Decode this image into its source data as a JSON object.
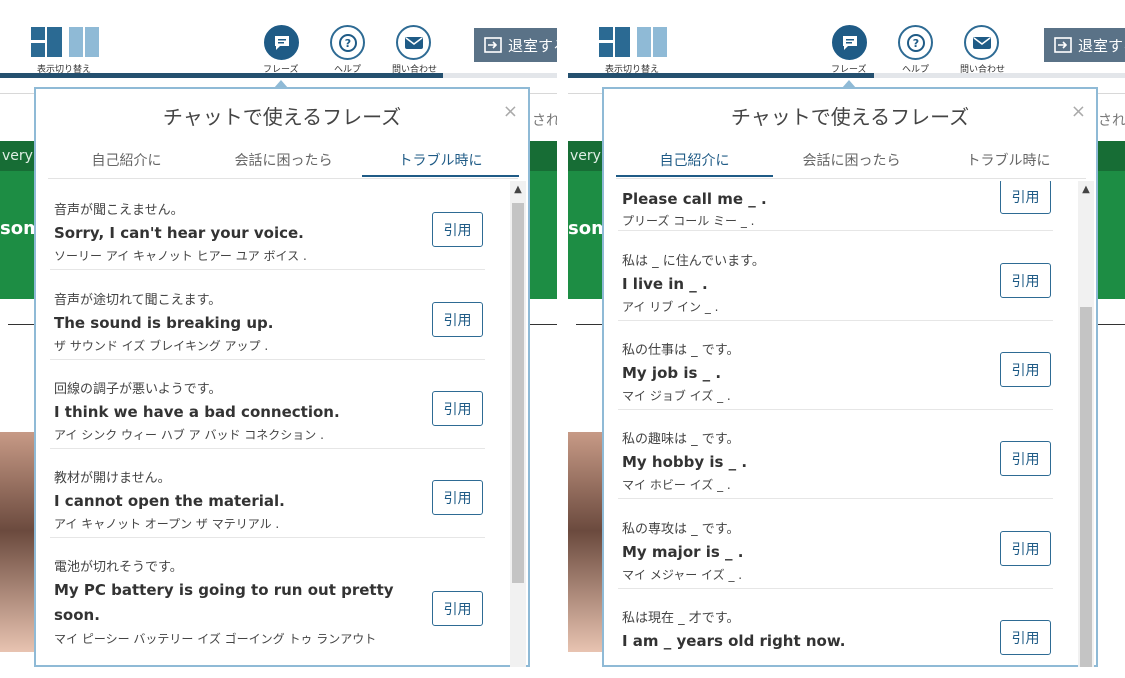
{
  "header": {
    "toggle_label": "表示切り替え",
    "phrase_label": "フレーズ",
    "help_label": "ヘルプ",
    "contact_label": "問い合わせ",
    "exit_label": "退室する"
  },
  "background": {
    "partial_text": "されま",
    "banner_text": "very",
    "banner_big": "som"
  },
  "panel": {
    "title": "チャットで使えるフレーズ",
    "close": "×",
    "tabs": [
      "自己紹介に",
      "会話に困ったら",
      "トラブル時に"
    ],
    "quote_label": "引用"
  },
  "left_list": [
    {
      "ja": "音声が聞こえません。",
      "en": "Sorry, I can't hear your voice.",
      "kana": "ソーリー アイ キャノット ヒアー ユア ボイス ."
    },
    {
      "ja": "音声が途切れて聞こえます。",
      "en": "The sound is breaking up.",
      "kana": "ザ サウンド イズ ブレイキング アップ ."
    },
    {
      "ja": "回線の調子が悪いようです。",
      "en": "I think we have a bad connection.",
      "kana": "アイ シンク ウィー ハブ ア バッド コネクション ."
    },
    {
      "ja": "教材が開けません。",
      "en": "I cannot open the material.",
      "kana": "アイ キャノット オープン ザ マテリアル ."
    },
    {
      "ja": "電池が切れそうです。",
      "en": "My PC battery is going to run out pretty soon.",
      "kana": "マイ ピーシー バッテリー イズ ゴーイング トゥ ランアウト"
    }
  ],
  "right_list": [
    {
      "ja": "",
      "en": "Please call me _ .",
      "kana": "プリーズ コール ミー _ ."
    },
    {
      "ja": "私は _ に住んでいます。",
      "en": "I live in _ .",
      "kana": "アイ リブ イン _ ."
    },
    {
      "ja": "私の仕事は _ です。",
      "en": "My job is _ .",
      "kana": "マイ ジョブ イズ _ ."
    },
    {
      "ja": "私の趣味は _ です。",
      "en": "My hobby is _ .",
      "kana": "マイ ホビー イズ _ ."
    },
    {
      "ja": "私の専攻は _ です。",
      "en": "My major is _ .",
      "kana": "マイ メジャー イズ _ ."
    },
    {
      "ja": "私は現在 _ 才です。",
      "en": "I am _ years old right now.",
      "kana": ""
    }
  ],
  "colors": {
    "accent": "#1f5b86",
    "panel_border": "#8fbad6",
    "banner_green": "#1d8d44"
  }
}
